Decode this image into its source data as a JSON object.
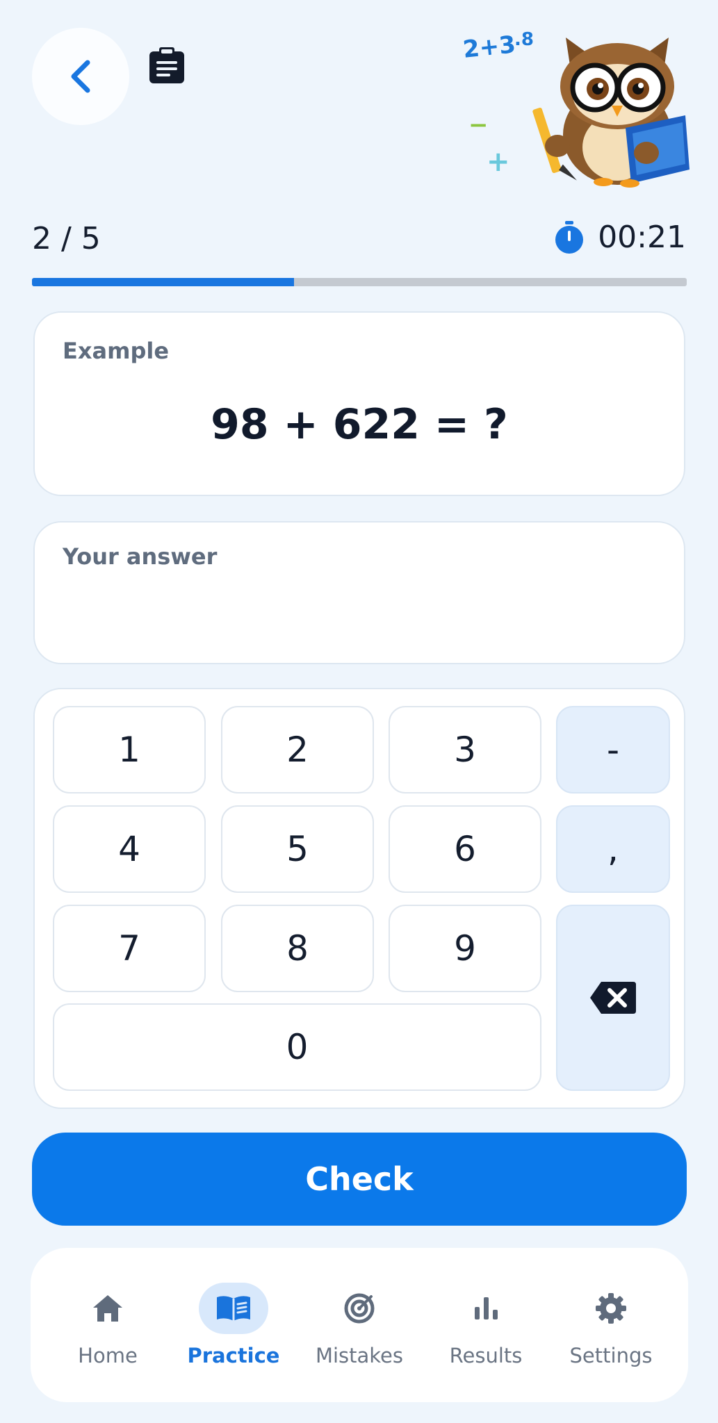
{
  "header": {
    "back_icon": "chevron-left-icon",
    "clipboard_icon": "clipboard-list-icon",
    "mascot": "owl-with-pencil-and-book",
    "mascot_math": [
      "2+3",
      ".8",
      "−",
      "+"
    ]
  },
  "status": {
    "counter": "2 / 5",
    "timer_icon": "stopwatch-icon",
    "timer": "00:21",
    "progress_fraction": 0.4
  },
  "example": {
    "label": "Example",
    "expression": "98 + 622 = ?"
  },
  "answer": {
    "label": "Your answer",
    "value": ""
  },
  "keypad": {
    "keys": [
      "1",
      "2",
      "3",
      "-",
      "4",
      "5",
      "6",
      ",",
      "7",
      "8",
      "9",
      "0"
    ],
    "backspace_icon": "backspace-icon"
  },
  "check_label": "Check",
  "nav": {
    "items": [
      {
        "label": "Home",
        "icon": "home-icon",
        "active": false
      },
      {
        "label": "Practice",
        "icon": "book-open-icon",
        "active": true
      },
      {
        "label": "Mistakes",
        "icon": "target-icon",
        "active": false
      },
      {
        "label": "Results",
        "icon": "bar-chart-icon",
        "active": false
      },
      {
        "label": "Settings",
        "icon": "gear-icon",
        "active": false
      }
    ]
  },
  "colors": {
    "accent": "#0b79ea",
    "background": "#eef5fc",
    "progress_track": "#c4c9d0"
  }
}
